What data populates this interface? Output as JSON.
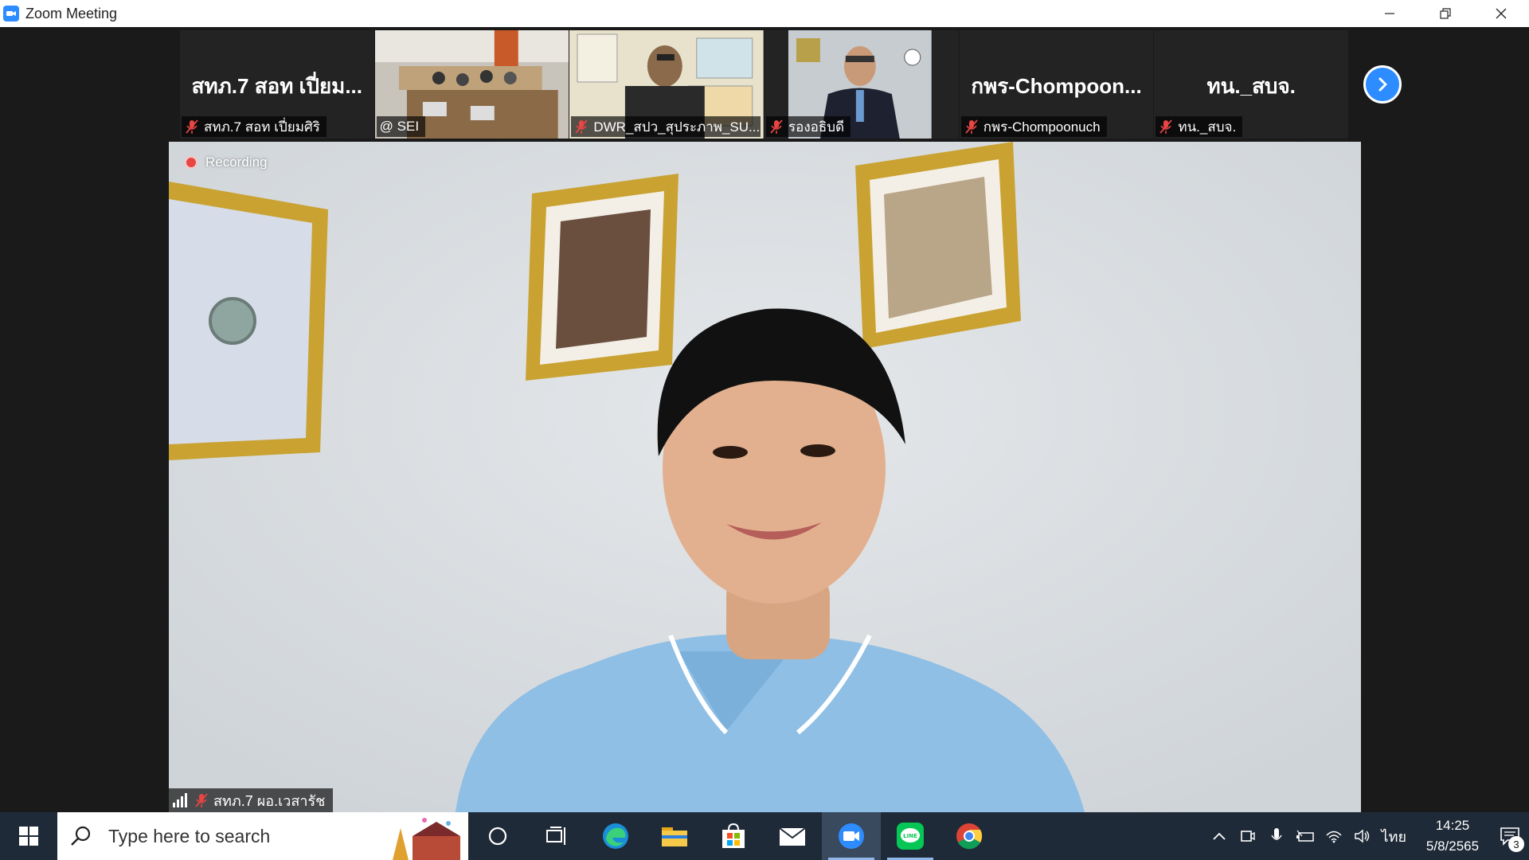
{
  "window": {
    "title": "Zoom Meeting"
  },
  "strip": {
    "tiles": [
      {
        "big_name": "สทภ.7 สอท เปี่ยม...",
        "label": "สทภ.7 สอท เปี่ยมศิริ",
        "muted": true,
        "video": false
      },
      {
        "big_name": "",
        "label": "@ SEI",
        "muted": false,
        "video": true
      },
      {
        "big_name": "",
        "label": "DWR_สปว_สุประภาพ_SU...",
        "muted": true,
        "video": true
      },
      {
        "big_name": "",
        "label": "รองอธิบดี",
        "muted": true,
        "video": true
      },
      {
        "big_name": "กพร-Chompoon...",
        "label": "กพร-Chompoonuch",
        "muted": true,
        "video": false
      },
      {
        "big_name": "ทน._สบจ.",
        "label": "ทน._สบจ.",
        "muted": true,
        "video": false
      }
    ]
  },
  "main_video": {
    "recording_label": "Recording",
    "speaker_label": "สทภ.7 ผอ.เวสารัช"
  },
  "taskbar": {
    "search_placeholder": "Type here to search",
    "language": "ไทย",
    "time": "14:25",
    "date": "5/8/2565",
    "notification_count": "3"
  },
  "colors": {
    "zoom_blue": "#2d8cff",
    "taskbar_bg": "#1f2a38",
    "recording_red": "#e84545"
  }
}
